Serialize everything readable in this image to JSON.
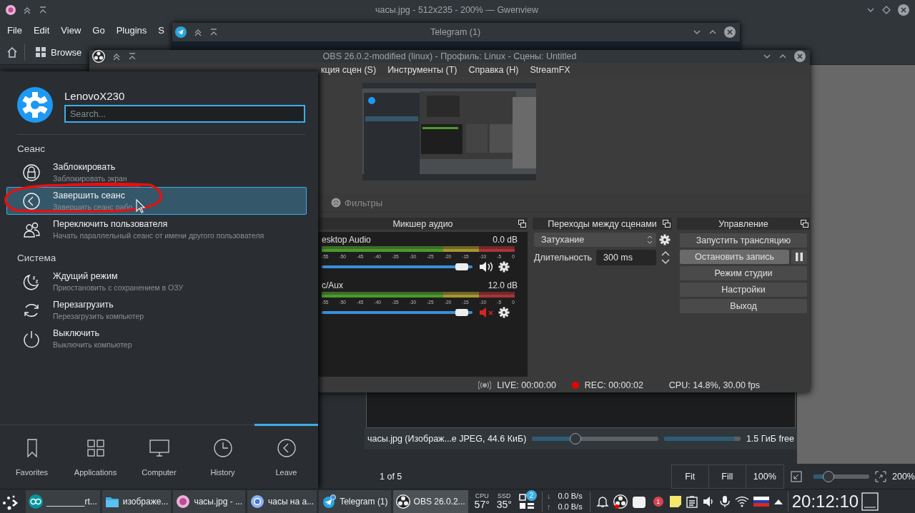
{
  "gwenview": {
    "title": "часы.jpg - 512x235 - 200% — Gwenview",
    "menu": [
      "File",
      "Edit",
      "View",
      "Go",
      "Plugins",
      "S"
    ],
    "browse": "Browse",
    "file_info": "часы.jpg (Изображ...е JPEG, 44.6 КиБ)",
    "thumbnail_slider": {
      "level": 0.33
    },
    "disk_usage": {
      "level": 0.93
    },
    "disk_free": "1.5 ГиБ free",
    "page_count": "1 of 5",
    "zoom_modes": [
      {
        "label": "Fit",
        "selected": false
      },
      {
        "label": "Fill",
        "selected": false
      },
      {
        "label": "100%",
        "selected": false
      }
    ],
    "zoom_slider": {
      "level": 0.2
    },
    "zoom": "200%"
  },
  "telegram": {
    "title": "Telegram (1)"
  },
  "obs": {
    "title": "OBS 26.0.2-modified (linux) - Профиль: Linux - Сцены: Untitled",
    "menu": [
      "кция сцен (S)",
      "Инструменты (T)",
      "Справка (H)",
      "StreamFX"
    ],
    "filters": "Фильтры",
    "mixer": {
      "title": "Микшер аудио",
      "channels": [
        {
          "name": "esktop Audio",
          "reading": "0.0 dB",
          "level": 0.98,
          "muted": false,
          "scale": [
            "-55",
            "-50",
            "-45",
            "-40",
            "-35",
            "-30",
            "-25",
            "-20",
            "-15",
            "-10",
            "-5",
            "0"
          ]
        },
        {
          "name": "c/Aux",
          "reading": "12.0 dB",
          "level": 0.98,
          "muted": true,
          "scale": [
            "-55",
            "-50",
            "-45",
            "-40",
            "-35",
            "-30",
            "-25",
            "-20",
            "-15",
            "-10",
            "-5",
            "0"
          ]
        }
      ]
    },
    "transitions": {
      "title": "Переходы между сценами",
      "type": "Затухание",
      "duration_label": "Длительность",
      "duration": "300 ms"
    },
    "controls": {
      "title": "Управление",
      "buttons": [
        {
          "label": "Запустить трансляцию",
          "active": false
        },
        {
          "label": "Остановить запись",
          "active": true
        },
        {
          "label": "Режим студии",
          "active": false
        },
        {
          "label": "Настройки",
          "active": false
        },
        {
          "label": "Выход",
          "active": false
        }
      ]
    },
    "status": {
      "live": "LIVE: 00:00:00",
      "rec": "REC: 00:00:02",
      "cpu": "CPU: 14.8%, 30.00 fps"
    }
  },
  "kickoff": {
    "user": "LenovoX230",
    "search_placeholder": "Search...",
    "sections": [
      {
        "title": "Сеанс",
        "items": [
          {
            "kind": "lock",
            "title": "Заблокировать",
            "subtitle": "Заблокировать экран",
            "selected": false
          },
          {
            "kind": "logout",
            "title": "Завершить сеанс",
            "subtitle": "Завершить сеанс рабо",
            "selected": true
          },
          {
            "kind": "switch",
            "title": "Переключить пользователя",
            "subtitle": "Начать параллельный сеанс от имени другого пользователя",
            "selected": false
          }
        ]
      },
      {
        "title": "Система",
        "items": [
          {
            "kind": "sleep",
            "title": "Ждущий режим",
            "subtitle": "Приостановить с сохранением в ОЗУ",
            "selected": false
          },
          {
            "kind": "restart",
            "title": "Перезагрузить",
            "subtitle": "Перезагрузить компьютер",
            "selected": false
          },
          {
            "kind": "shutdown",
            "title": "Выключить",
            "subtitle": "Выключить компьютер",
            "selected": false
          }
        ]
      }
    ],
    "tabs": [
      {
        "kind": "favorites",
        "label": "Favorites",
        "selected": false
      },
      {
        "kind": "applications",
        "label": "Applications",
        "selected": false
      },
      {
        "kind": "computer",
        "label": "Computer",
        "selected": false
      },
      {
        "kind": "history",
        "label": "History",
        "selected": false
      },
      {
        "kind": "leave",
        "label": "Leave",
        "selected": true
      }
    ]
  },
  "taskbar": {
    "tasks": [
      {
        "kind": "arduino",
        "label": "________rt...",
        "active": false
      },
      {
        "kind": "folder",
        "label": "изображе...",
        "active": false
      },
      {
        "kind": "gwenview",
        "label": "часы.jpg - ...",
        "active": false
      },
      {
        "kind": "chrome",
        "label": "часы на а...",
        "active": false
      },
      {
        "kind": "telegram",
        "label": "Telegram (1)",
        "active": false
      },
      {
        "kind": "obs",
        "label": "OBS 26.0.2...",
        "active": true
      }
    ],
    "cpu_label": "CPU",
    "cpu_temp": "57°",
    "ssd_label": "SSD",
    "ssd_temp": "35°",
    "pager_badge": "2",
    "down_arrow": "↓",
    "net_down": "0.0 B/s",
    "up_arrow": "↑",
    "net_up": "0.0 B/s",
    "tray_badge": "1",
    "clock": "20:12:10"
  }
}
